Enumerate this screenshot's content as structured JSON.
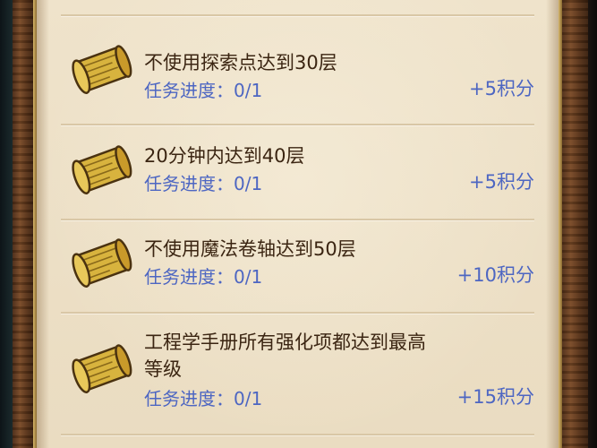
{
  "tasks": [
    {
      "name": "不使用探索点达到30层",
      "progress": "任务进度：0/1",
      "reward": "+5积分",
      "icon": "scroll-icon"
    },
    {
      "name": "20分钟内达到40层",
      "progress": "任务进度：0/1",
      "reward": "+5积分",
      "icon": "scroll-icon"
    },
    {
      "name": "不使用魔法卷轴达到50层",
      "progress": "任务进度：0/1",
      "reward": "+10积分",
      "icon": "scroll-icon"
    },
    {
      "name_line1": "工程学手册所有强化项都达到最高",
      "name_line2": "等级",
      "progress": "任务进度：0/1",
      "reward": "+15积分",
      "icon": "scroll-icon"
    }
  ],
  "colors": {
    "parchment": "#efe3cb",
    "title_text": "#3b2512",
    "progress_text": "#4d66c2",
    "frame_wood": "#6a3f20"
  }
}
